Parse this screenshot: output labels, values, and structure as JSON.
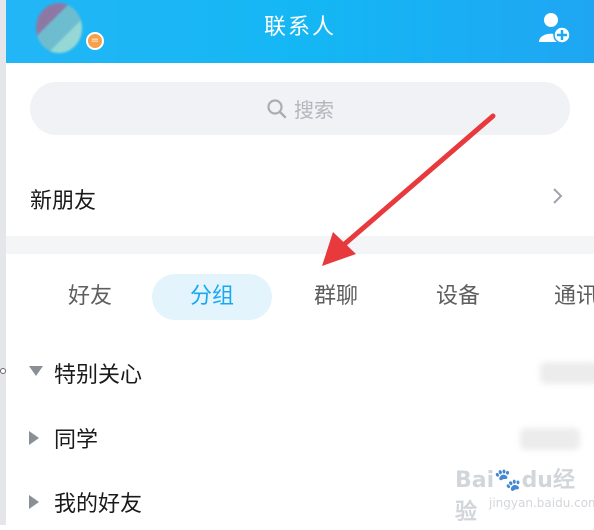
{
  "header": {
    "title": "联系人",
    "badge_icon": "equals-badge-icon"
  },
  "search": {
    "placeholder": "搜索"
  },
  "new_friend": {
    "label": "新朋友"
  },
  "tabs": [
    {
      "label": "好友",
      "active": false
    },
    {
      "label": "分组",
      "active": true
    },
    {
      "label": "群聊",
      "active": false
    },
    {
      "label": "设备",
      "active": false
    },
    {
      "label": "通讯",
      "active": false
    }
  ],
  "groups": [
    {
      "label": "特别关心",
      "expanded": true
    },
    {
      "label": "同学",
      "expanded": false
    },
    {
      "label": "我的好友",
      "expanded": false
    }
  ],
  "watermark": {
    "brand": "Bai",
    "paw": "du",
    "jingyan": "经验",
    "url": "jingyan.baidu.com"
  },
  "colors": {
    "header": "#14b7f4",
    "active_tab_text": "#19a7f2",
    "active_tab_bg": "#e4f4fd",
    "arrow": "#e8393d"
  }
}
